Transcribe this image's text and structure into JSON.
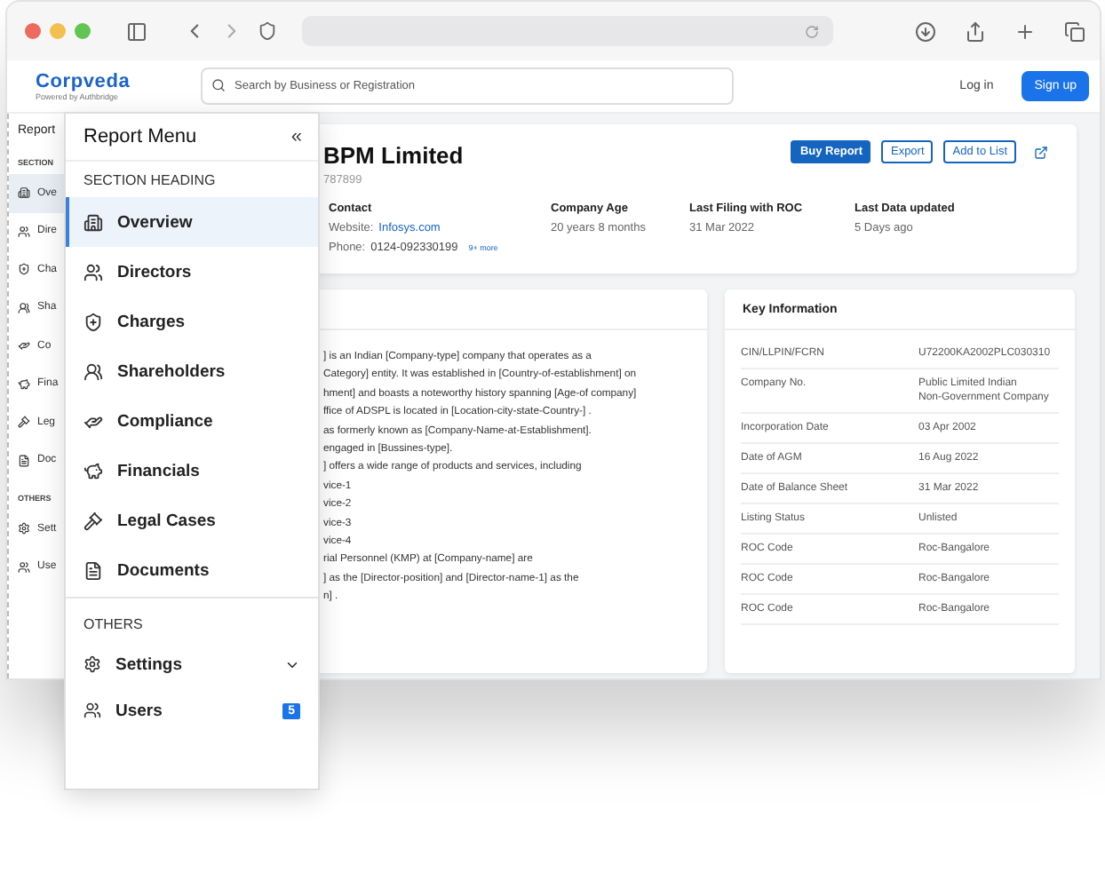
{
  "header": {
    "logo": "Corpveda",
    "tagline": "Powered by Authbridge",
    "search": {
      "placeholder": "Search by Business or Registration"
    },
    "login": "Log in",
    "signup": "Sign up"
  },
  "sidebar": {
    "title": "Report",
    "section": "SECTION",
    "items": [
      {
        "label": "Ove",
        "selected": true
      },
      {
        "label": "Dire",
        "selected": false
      },
      {
        "label": "Cha",
        "selected": false
      },
      {
        "label": "Sha",
        "selected": false
      },
      {
        "label": "Co",
        "selected": false
      },
      {
        "label": "Fina",
        "selected": false
      },
      {
        "label": "Leg",
        "selected": false
      },
      {
        "label": "Doc",
        "selected": false
      }
    ],
    "others_heading": "OTHERS",
    "others": [
      {
        "label": "Sett"
      },
      {
        "label": "Use"
      }
    ]
  },
  "company": {
    "name": "BPM Limited",
    "number": "787899",
    "actions": [
      {
        "label": "Buy Report",
        "kind": "primary"
      },
      {
        "label": "Export",
        "kind": "outline"
      },
      {
        "label": "Add to List",
        "kind": "outline"
      }
    ],
    "contact": {
      "label": "Contact",
      "website_label": "Website:",
      "website": "Infosys.com",
      "phone_label": "Phone:",
      "phone": "0124-092330199",
      "more": "9+ more"
    },
    "facts": [
      {
        "label": "Company Age",
        "value": "20 years 8 months"
      },
      {
        "label": "Last Filing with ROC",
        "value": "31 Mar 2022"
      },
      {
        "label": "Last Data updated",
        "value": "5 Days ago"
      }
    ]
  },
  "about": {
    "lines": [
      "] is an Indian [Company-type] company that operates as a",
      "Category]  entity. It was established in [Country-of-establishment] on",
      "hment] and boasts a noteworthy history spanning [Age-of company]",
      "ffice of ADSPL is located in  [Location-city-state-Country-] .",
      "as formerly known as [Company-Name-at-Establishment].",
      "engaged in [Bussines-type].",
      "] offers a wide range of products and services, including",
      "vice-1",
      "vice-2",
      "vice-3",
      "vice-4",
      "rial Personnel (KMP) at [Company-name] are",
      "] as the [Director-position] and [Director-name-1] as the",
      "n] ."
    ]
  },
  "key_information": {
    "title": "Key Information",
    "rows": [
      {
        "label": "CIN/LLPIN/FCRN",
        "lines": [
          "U72200KA2002PLC030310"
        ]
      },
      {
        "label": "Company No.",
        "lines": [
          "Public Limited Indian",
          "Non-Government Company"
        ]
      },
      {
        "label": "Incorporation Date",
        "lines": [
          "03 Apr 2002"
        ]
      },
      {
        "label": "Date of AGM",
        "lines": [
          "16 Aug 2022"
        ]
      },
      {
        "label": "Date of Balance Sheet",
        "lines": [
          "31 Mar 2022"
        ]
      },
      {
        "label": "Listing Status",
        "lines": [
          "Unlisted"
        ]
      },
      {
        "label": "ROC Code",
        "lines": [
          "Roc-Bangalore"
        ]
      },
      {
        "label": "ROC Code",
        "lines": [
          "Roc-Bangalore"
        ]
      },
      {
        "label": "ROC Code",
        "lines": [
          "Roc-Bangalore"
        ]
      }
    ]
  },
  "menu": {
    "title": "Report Menu",
    "collapse": "«",
    "section_heading": "SECTION HEADING",
    "items": [
      {
        "label": "Overview",
        "selected": true
      },
      {
        "label": "Directors",
        "selected": false
      },
      {
        "label": "Charges",
        "selected": false
      },
      {
        "label": "Shareholders",
        "selected": false
      },
      {
        "label": "Compliance",
        "selected": false
      },
      {
        "label": "Financials",
        "selected": false
      },
      {
        "label": "Legal Cases",
        "selected": false
      },
      {
        "label": "Documents",
        "selected": false
      }
    ],
    "others_heading": "OTHERS",
    "others": [
      {
        "label": "Settings",
        "expanded": false
      },
      {
        "label": "Users",
        "badge": "5"
      }
    ]
  }
}
